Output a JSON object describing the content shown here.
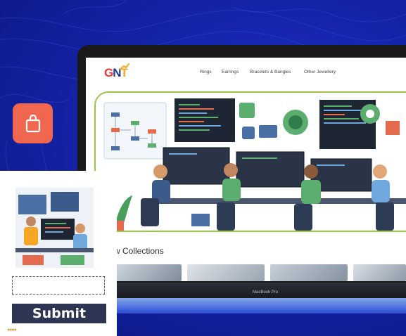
{
  "logo": {
    "g": "G",
    "n": "N",
    "t": "T"
  },
  "nav": {
    "items": [
      {
        "label": "Rings"
      },
      {
        "label": "Earrings"
      },
      {
        "label": "Bracelets & Bangles"
      },
      {
        "label": "Other Jewellery"
      }
    ]
  },
  "collections": {
    "title": "w Collections"
  },
  "laptop": {
    "model_label": "MacBook Pro"
  },
  "bag_button": {
    "icon": "shopping-bag-icon",
    "color": "#f0664e"
  },
  "form": {
    "submit_label": "Submit",
    "input_value": ""
  },
  "colors": {
    "background": "#1424a8",
    "accent": "#9ac34a",
    "submit": "#2d3552"
  }
}
